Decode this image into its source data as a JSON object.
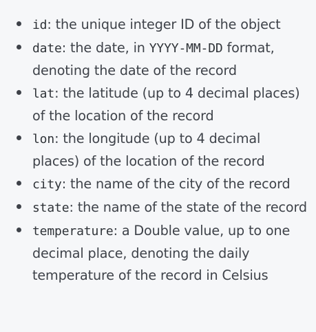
{
  "fields": [
    {
      "name": "id",
      "description": ": the unique integer ID of the object"
    },
    {
      "name": "date",
      "description_before": ": the date, in ",
      "format_code": "YYYY-MM-DD",
      "description_after": " format, denoting the date of the record"
    },
    {
      "name": "lat",
      "description": ": the latitude (up to 4 decimal places) of the location of the record"
    },
    {
      "name": "lon",
      "description": ": the longitude (up to 4 decimal places) of the location of the record"
    },
    {
      "name": "city",
      "description": ": the name of the city of the record"
    },
    {
      "name": "state",
      "description": ": the name of the state of the record"
    },
    {
      "name": "temperature",
      "description": ": a Double value, up to one decimal place, denoting the daily temperature of the record in Celsius"
    }
  ]
}
